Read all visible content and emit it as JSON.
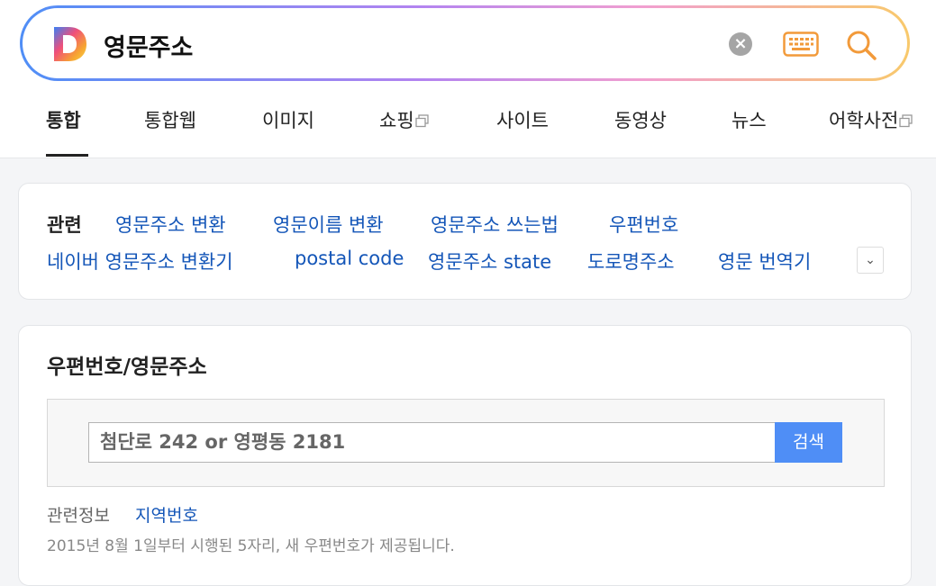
{
  "search": {
    "query": "영문주소"
  },
  "tabs": [
    {
      "label": "통합"
    },
    {
      "label": "통합웹"
    },
    {
      "label": "이미지"
    },
    {
      "label": "쇼핑"
    },
    {
      "label": "사이트"
    },
    {
      "label": "동영상"
    },
    {
      "label": "뉴스"
    },
    {
      "label": "어학사전"
    }
  ],
  "related": {
    "label": "관련",
    "links": [
      "영문주소 변환",
      "영문이름 변환",
      "영문주소 쓰는법",
      "우편번호",
      "네이버 영문주소 변환기",
      "postal code",
      "영문주소 state",
      "도로명주소",
      "영문 번역기"
    ]
  },
  "postal": {
    "title": "우편번호/영문주소",
    "input_placeholder": "첨단로 242 or 영평동 2181",
    "submit_label": "검색",
    "info_label": "관련정보",
    "info_link": "지역번호",
    "notice": "2015년 8월 1일부터 시행된 5자리, 새 우편번호가 제공됩니다."
  },
  "colors": {
    "link": "#1456b8",
    "accent_button": "#4f8ef6",
    "search_icon": "#f29a3a"
  },
  "icons": {
    "clear": "close-circle-icon",
    "keyboard": "keyboard-icon",
    "search": "search-icon",
    "external": "new-window-icon",
    "expand": "chevron-down-icon"
  }
}
